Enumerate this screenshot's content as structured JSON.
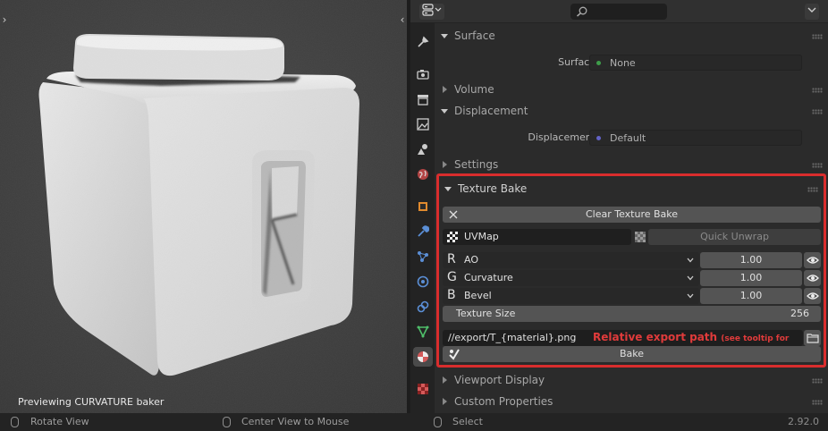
{
  "viewport": {
    "preview_text": "Previewing CURVATURE baker",
    "left_toggle": "›",
    "right_toggle": "‹"
  },
  "properties": {
    "sections": {
      "surface": "Surface",
      "volume": "Volume",
      "displacement": "Displacement",
      "settings": "Settings",
      "texture_bake": "Texture Bake",
      "viewport_display": "Viewport Display",
      "custom_properties": "Custom Properties"
    },
    "surface_row": {
      "label": "Surface",
      "value": "None",
      "dot_color": "#3e9d4a"
    },
    "displacement_row": {
      "label": "Displacement",
      "value": "Default",
      "dot_color": "#6363c7"
    }
  },
  "texture_bake": {
    "clear_button": "Clear Texture Bake",
    "uv_map": "UVMap",
    "quick_unwrap": "Quick Unwrap",
    "channels": [
      {
        "letter": "R",
        "name": "AO",
        "value": "1.00"
      },
      {
        "letter": "G",
        "name": "Curvature",
        "value": "1.00"
      },
      {
        "letter": "B",
        "name": "Bevel",
        "value": "1.00"
      }
    ],
    "texture_size_label": "Texture Size",
    "texture_size_value": "256",
    "export_path": "//export/T_{material}.png",
    "export_hint": "Relative export path",
    "export_hint_small": "(see tooltip for info)",
    "bake_button": "Bake",
    "highlight_color": "#d92d2d"
  },
  "statusbar": {
    "rotate": "Rotate View",
    "center": "Center View to Mouse",
    "select": "Select",
    "version": "2.92.0"
  }
}
